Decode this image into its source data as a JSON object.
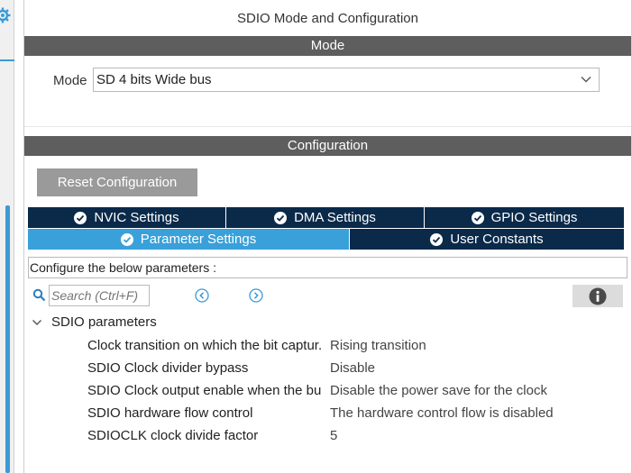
{
  "window": {
    "title": "SDIO Mode and Configuration"
  },
  "mode_section": {
    "header": "Mode",
    "mode_label": "Mode",
    "mode_value": "SD 4 bits Wide bus"
  },
  "config_section": {
    "header": "Configuration",
    "reset_button": "Reset Configuration",
    "tabs_row1": [
      {
        "label": "NVIC Settings"
      },
      {
        "label": "DMA Settings"
      },
      {
        "label": "GPIO Settings"
      }
    ],
    "tabs_row2": [
      {
        "label": "Parameter Settings",
        "active": true
      },
      {
        "label": "User Constants"
      }
    ],
    "describe_text": "Configure the below parameters :",
    "search_placeholder": "Search (Ctrl+F)"
  },
  "parameters": {
    "group_label": "SDIO parameters",
    "rows": [
      {
        "name": "Clock transition on which the bit captur.",
        "value": "Rising transition"
      },
      {
        "name": "SDIO Clock divider bypass",
        "value": "Disable"
      },
      {
        "name": "SDIO Clock output enable when the bu",
        "value": "Disable the power save for the clock"
      },
      {
        "name": "SDIO hardware flow control",
        "value": "The hardware control flow is disabled"
      },
      {
        "name": "SDIOCLK clock divide factor",
        "value": "5"
      }
    ]
  },
  "colors": {
    "accent_blue": "#39a0da",
    "tab_dark": "#0b2a4a",
    "section_bar": "#5e5e5e",
    "reset_button": "#9a9a9a"
  },
  "icons": {
    "left_gear": "gear-icon",
    "mode_dropdown": "chevron-down-icon",
    "tab_check": "check-circle-icon",
    "search": "search-icon",
    "prev": "chevron-left-circle-icon",
    "next": "chevron-right-circle-icon",
    "info": "info-icon",
    "group_collapse": "chevron-down-icon"
  }
}
